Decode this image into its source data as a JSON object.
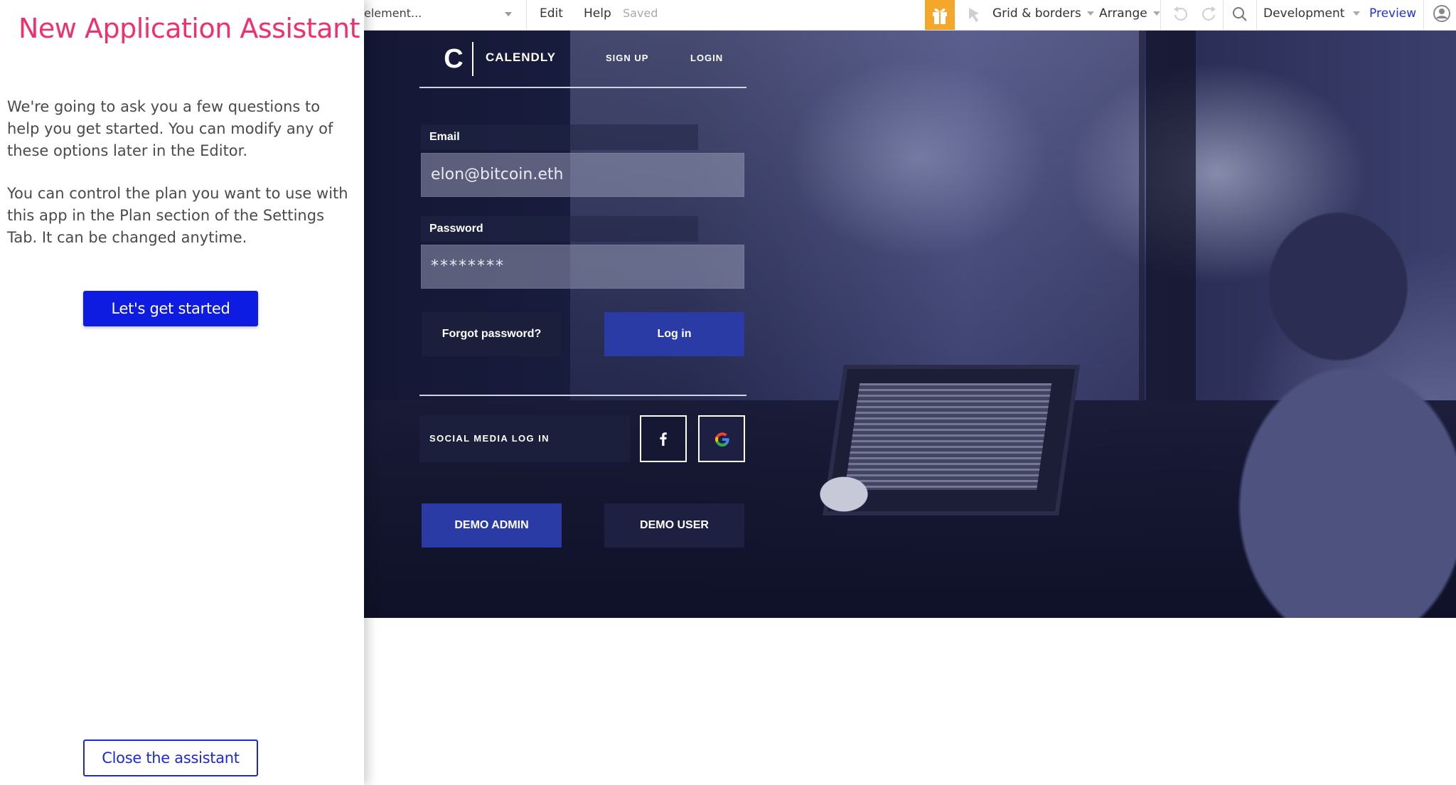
{
  "assistant": {
    "title": "New Application Assistant",
    "paragraph1": "We're going to ask you a few questions to help you get started. You can modify any of these options later in the Editor.",
    "paragraph2": "You can control the plan you want to use with this app in the Plan section of the Settings Tab. It can be changed anytime.",
    "start_label": "Let's get started",
    "close_label": "Close the assistant",
    "title_color": "#f0306a",
    "button_color": "#0e1be0"
  },
  "toolbar": {
    "element_select": "element...",
    "edit": "Edit",
    "help": "Help",
    "saved": "Saved",
    "grid_borders": "Grid & borders",
    "arrange": "Arrange",
    "environment": "Development",
    "preview": "Preview",
    "icons": [
      "gift-icon",
      "cursor-icon",
      "undo-icon",
      "redo-icon",
      "search-icon",
      "user-icon"
    ]
  },
  "page": {
    "logo_letter": "C",
    "brand": "CALENDLY",
    "nav": {
      "signup": "SIGN UP",
      "login": "LOGIN"
    },
    "email_label": "Email",
    "email_value": "elon@bitcoin.eth",
    "password_label": "Password",
    "password_value": "********",
    "forgot_label": "Forgot password?",
    "login_label": "Log in",
    "social_label": "SOCIAL MEDIA LOG IN",
    "demo_admin_label": "DEMO ADMIN",
    "demo_user_label": "DEMO USER",
    "accent_color": "#2b3ba6"
  }
}
